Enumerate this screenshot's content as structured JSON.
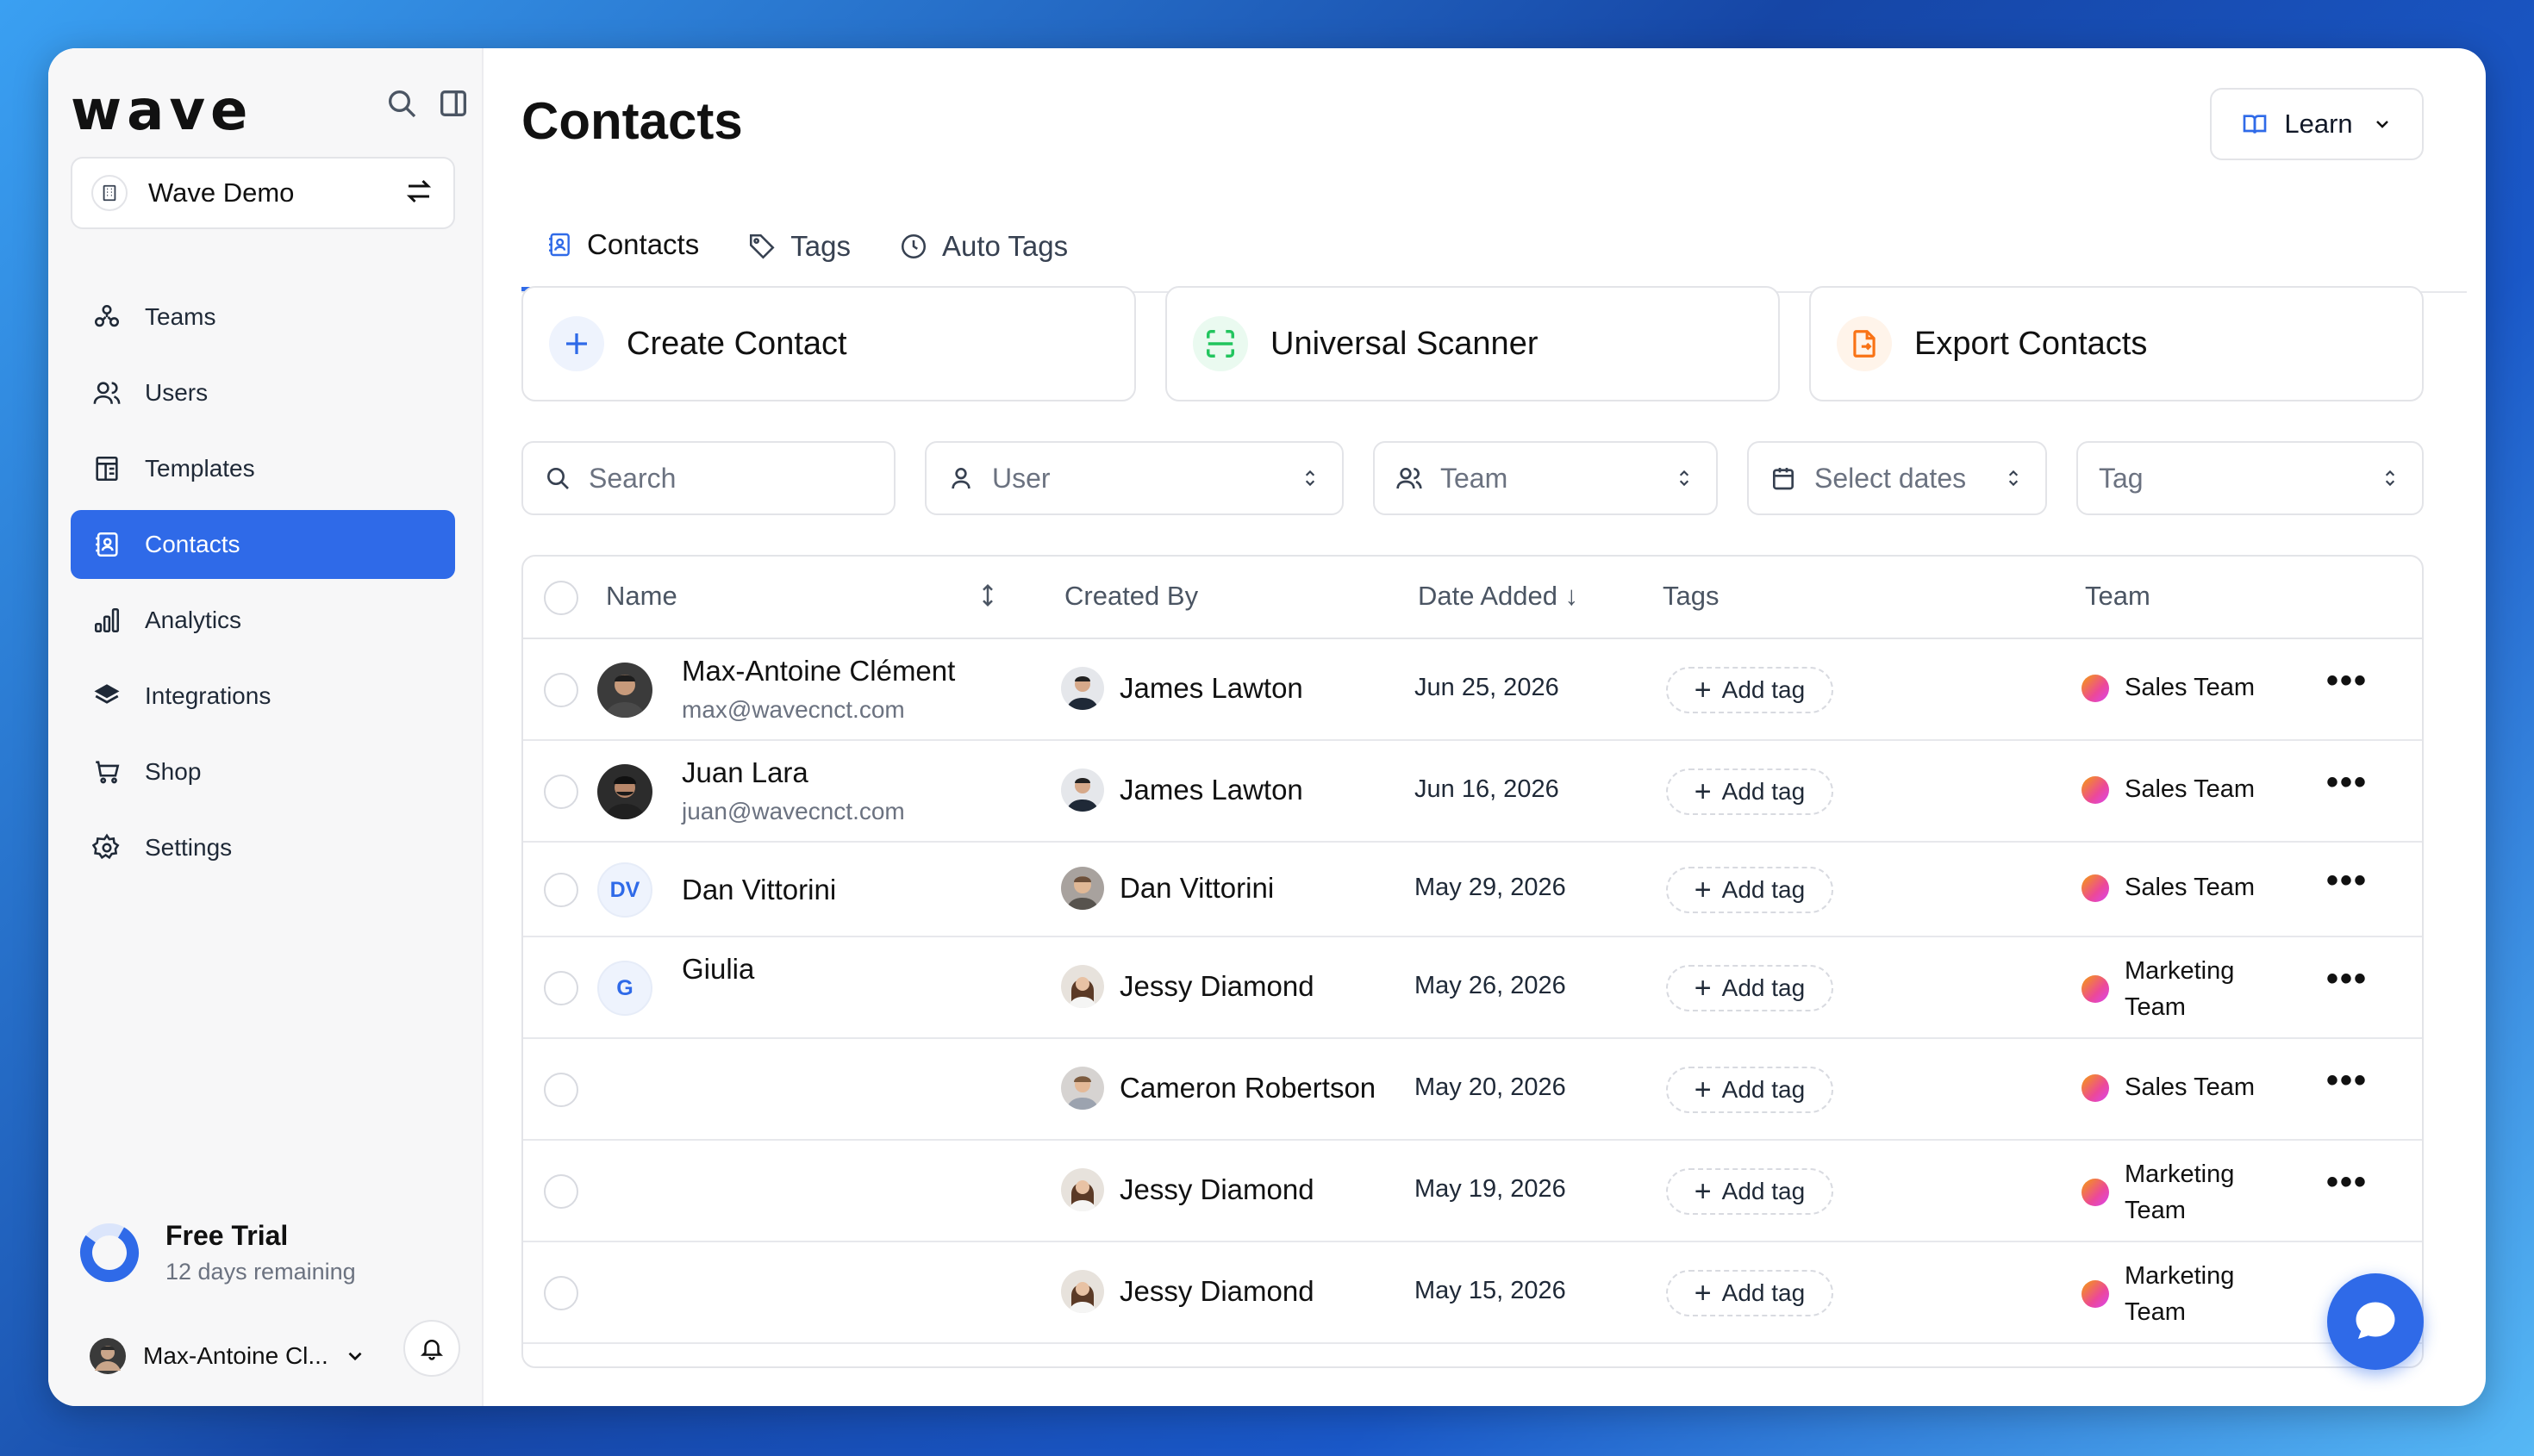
{
  "app": {
    "logo_text": "wave",
    "workspace": "Wave Demo"
  },
  "sidebar": {
    "items": [
      {
        "label": "Teams",
        "icon": "teams-icon"
      },
      {
        "label": "Users",
        "icon": "users-icon"
      },
      {
        "label": "Templates",
        "icon": "templates-icon"
      },
      {
        "label": "Contacts",
        "icon": "contacts-icon",
        "active": true
      },
      {
        "label": "Analytics",
        "icon": "analytics-icon"
      },
      {
        "label": "Integrations",
        "icon": "integrations-icon"
      },
      {
        "label": "Shop",
        "icon": "shop-icon"
      },
      {
        "label": "Settings",
        "icon": "settings-icon"
      }
    ],
    "trial": {
      "title": "Free Trial",
      "subtitle": "12 days remaining"
    },
    "user": {
      "name": "Max-Antoine Cl..."
    }
  },
  "header": {
    "title": "Contacts",
    "learn_label": "Learn"
  },
  "tabs": [
    {
      "label": "Contacts",
      "active": true
    },
    {
      "label": "Tags"
    },
    {
      "label": "Auto Tags"
    }
  ],
  "actions": {
    "create": "Create Contact",
    "scanner": "Universal Scanner",
    "export": "Export Contacts"
  },
  "filters": {
    "search_placeholder": "Search",
    "user": "User",
    "team": "Team",
    "dates": "Select dates",
    "tag": "Tag"
  },
  "table": {
    "headers": {
      "name": "Name",
      "created_by": "Created By",
      "date_added": "Date Added ↓",
      "tags": "Tags",
      "team": "Team"
    },
    "add_tag_label": "Add tag",
    "rows": [
      {
        "name": "Max-Antoine Clément",
        "email": "max@wavecnct.com",
        "avatar": "photo",
        "created_by": "James Lawton",
        "date": "Jun 25, 2026",
        "team": "Sales Team"
      },
      {
        "name": "Juan Lara",
        "email": "juan@wavecnct.com",
        "avatar": "photo",
        "created_by": "James Lawton",
        "date": "Jun 16, 2026",
        "team": "Sales Team"
      },
      {
        "name": "Dan Vittorini",
        "email": "",
        "avatar_initials": "DV",
        "created_by": "Dan Vittorini",
        "date": "May 29, 2026",
        "team": "Sales Team"
      },
      {
        "name": "Giulia",
        "email": "",
        "avatar_initials": "G",
        "created_by": "Jessy Diamond",
        "date": "May 26, 2026",
        "team_line1": "Marketing",
        "team_line2": "Team"
      },
      {
        "name": "",
        "email": "",
        "created_by": "Cameron Robertson",
        "date": "May 20, 2026",
        "team": "Sales Team"
      },
      {
        "name": "",
        "email": "",
        "created_by": "Jessy Diamond",
        "date": "May 19, 2026",
        "team_line1": "Marketing",
        "team_line2": "Team"
      },
      {
        "name": "",
        "email": "",
        "created_by": "Jessy Diamond",
        "date": "May 15, 2026",
        "team_line1": "Marketing",
        "team_line2": "Team"
      }
    ]
  },
  "colors": {
    "accent": "#2f6ae8",
    "scanner": "#22c55e",
    "export": "#f97316"
  }
}
